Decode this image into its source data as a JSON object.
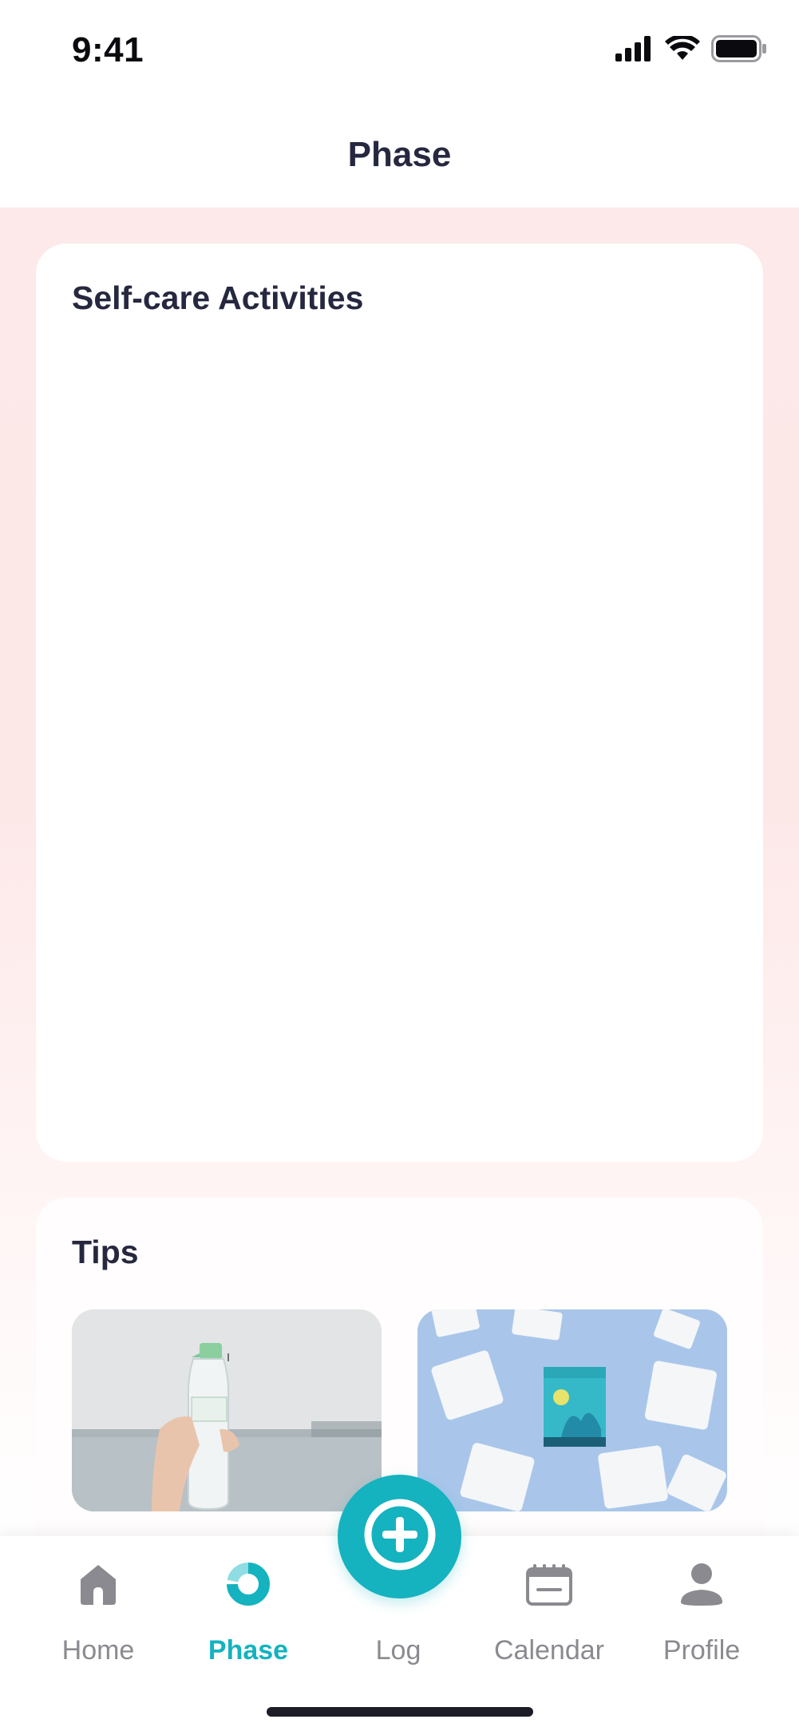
{
  "status_bar": {
    "time": "9:41",
    "icons": [
      "cellular-signal-icon",
      "wifi-icon",
      "battery-icon"
    ]
  },
  "header": {
    "title": "Phase"
  },
  "sections": {
    "self_care": {
      "title": "Self-care Activities"
    },
    "tips": {
      "title": "Tips",
      "cards": [
        {
          "image": "water-bottle-photo"
        },
        {
          "image": "sanitary-pads-photo"
        }
      ]
    }
  },
  "fab": {
    "icon": "plus-circle-icon"
  },
  "tab_bar": {
    "items": [
      {
        "label": "Home",
        "icon": "home-icon"
      },
      {
        "label": "Phase",
        "icon": "phase-donut-icon"
      },
      {
        "label": "Log",
        "icon": "plus-circle-icon"
      },
      {
        "label": "Calendar",
        "icon": "calendar-icon"
      },
      {
        "label": "Profile",
        "icon": "profile-icon"
      }
    ],
    "active": "Phase"
  },
  "colors": {
    "accent": "#15b2bf",
    "title_text": "#262840",
    "inactive_tab": "#8a8a90",
    "background_tint": "#fde9e9"
  }
}
